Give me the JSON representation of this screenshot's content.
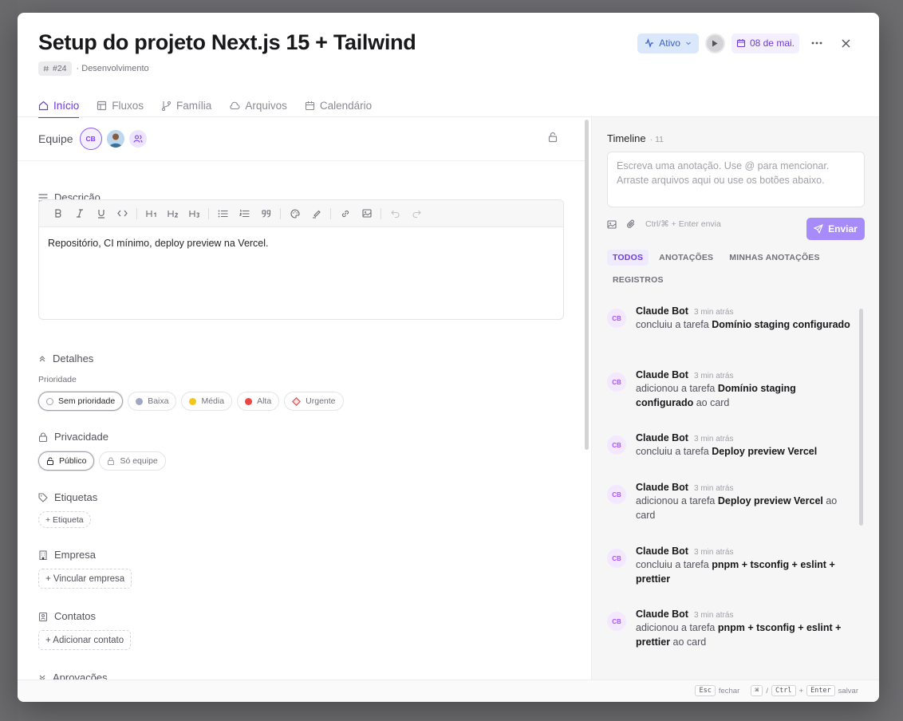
{
  "task": {
    "title": "Setup do projeto Next.js 15 + Tailwind",
    "id_label": "#24",
    "category": "· Desenvolvimento",
    "status_label": "Ativo",
    "date_label": "08 de mai."
  },
  "tabs": [
    {
      "label": "Início",
      "icon": "home-icon",
      "active": true
    },
    {
      "label": "Fluxos",
      "icon": "table-icon",
      "active": false
    },
    {
      "label": "Família",
      "icon": "branch-icon",
      "active": false
    },
    {
      "label": "Arquivos",
      "icon": "cloud-icon",
      "active": false
    },
    {
      "label": "Calendário",
      "icon": "calendar-icon",
      "active": false
    }
  ],
  "team": {
    "label": "Equipe",
    "member_initials": "CB"
  },
  "description": {
    "title": "Descrição",
    "content": "Repositório, CI mínimo, deploy preview na Vercel.",
    "toolbar": [
      "bold",
      "italic",
      "underline",
      "code",
      "h1",
      "h2",
      "h3",
      "bullet-list",
      "ordered-list",
      "quote",
      "color",
      "highlight",
      "link",
      "image",
      "undo",
      "redo"
    ]
  },
  "details": {
    "title": "Detalhes",
    "priority_label": "Prioridade",
    "priorities": [
      {
        "label": "Sem prioridade",
        "color": "#ffffff",
        "selected": true
      },
      {
        "label": "Baixa",
        "color": "#a1a8c3",
        "selected": false
      },
      {
        "label": "Média",
        "color": "#f5c518",
        "selected": false
      },
      {
        "label": "Alta",
        "color": "#ef4444",
        "selected": false
      },
      {
        "label": "Urgente",
        "color": "#f87171",
        "selected": false
      }
    ],
    "privacy_title": "Privacidade",
    "privacy_options": [
      {
        "label": "Público",
        "selected": true
      },
      {
        "label": "Só equipe",
        "selected": false
      }
    ],
    "tags_title": "Etiquetas",
    "tag_add": "+ Etiqueta",
    "company_title": "Empresa",
    "company_add": "+ Vincular empresa",
    "contacts_title": "Contatos",
    "contacts_add": "+ Adicionar contato",
    "approvals_title": "Aprovações"
  },
  "timeline": {
    "title": "Timeline",
    "count": "· 11",
    "placeholder": "Escreva uma anotação. Use @ para mencionar. Arraste arquivos aqui ou use os botões abaixo.",
    "hint": "Ctrl/⌘ + Enter envia",
    "send_label": "Enviar",
    "filters": [
      "TODOS",
      "ANOTAÇÕES",
      "MINHAS ANOTAÇÕES",
      "REGISTROS"
    ],
    "items": [
      {
        "initials": "CB",
        "name": "Claude Bot",
        "time": "3 min atrás",
        "action": "concluiu a tarefa ",
        "target": "Domínio staging configurado",
        "suffix": ""
      },
      {
        "initials": "CB",
        "name": "Claude Bot",
        "time": "3 min atrás",
        "action": "adicionou a tarefa ",
        "target": "Domínio staging configurado",
        "suffix": " ao card"
      },
      {
        "initials": "CB",
        "name": "Claude Bot",
        "time": "3 min atrás",
        "action": "concluiu a tarefa ",
        "target": "Deploy preview Vercel",
        "suffix": ""
      },
      {
        "initials": "CB",
        "name": "Claude Bot",
        "time": "3 min atrás",
        "action": "adicionou a tarefa ",
        "target": "Deploy preview Vercel",
        "suffix": " ao card"
      },
      {
        "initials": "CB",
        "name": "Claude Bot",
        "time": "3 min atrás",
        "action": "concluiu a tarefa ",
        "target": "pnpm + tsconfig + eslint + prettier",
        "suffix": ""
      },
      {
        "initials": "CB",
        "name": "Claude Bot",
        "time": "3 min atrás",
        "action": "adicionou a tarefa ",
        "target": "pnpm + tsconfig + eslint + prettier",
        "suffix": " ao card"
      }
    ]
  },
  "footer": {
    "esc_key": "Esc",
    "esc_label": "fechar",
    "cmd_key": "⌘",
    "slash": "/",
    "ctrl_key": "Ctrl",
    "plus": "+",
    "enter_key": "Enter",
    "save_label": "salvar"
  },
  "colors": {
    "accent": "#6d3bd9",
    "status_bg": "#dbe7fb",
    "send_bg": "#a78bfa"
  }
}
